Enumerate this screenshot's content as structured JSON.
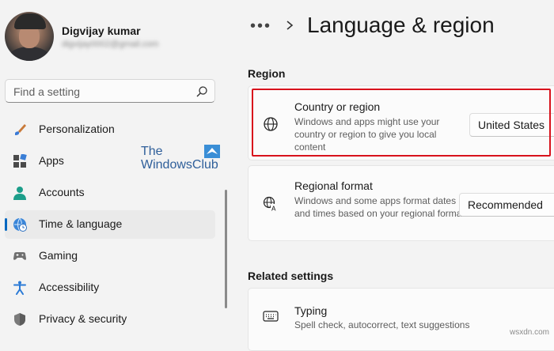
{
  "user": {
    "name": "Digvijay kumar",
    "email": "digvijay0002@gmail.com"
  },
  "search": {
    "placeholder": "Find a setting"
  },
  "nav": [
    {
      "label": "Personalization",
      "icon": "brush-icon"
    },
    {
      "label": "Apps",
      "icon": "apps-icon"
    },
    {
      "label": "Accounts",
      "icon": "person-icon"
    },
    {
      "label": "Time & language",
      "icon": "globe-clock-icon",
      "active": true
    },
    {
      "label": "Gaming",
      "icon": "gamepad-icon"
    },
    {
      "label": "Accessibility",
      "icon": "accessibility-icon"
    },
    {
      "label": "Privacy & security",
      "icon": "shield-icon"
    }
  ],
  "watermark": {
    "line1": "The",
    "line2": "WindowsClub"
  },
  "breadcrumb": {
    "more": "•••",
    "title": "Language & region"
  },
  "region": {
    "heading": "Region",
    "country": {
      "title": "Country or region",
      "description": "Windows and apps might use your country or region to give you local content",
      "value": "United States"
    },
    "format": {
      "title": "Regional format",
      "description": "Windows and some apps format dates and times based on your regional format",
      "value": "Recommended"
    }
  },
  "related": {
    "heading": "Related settings",
    "typing": {
      "title": "Typing",
      "description": "Spell check, autocorrect, text suggestions"
    }
  },
  "site_watermark": "wsxdn.com",
  "colors": {
    "accent": "#0067c0",
    "highlight": "#d8121c"
  }
}
